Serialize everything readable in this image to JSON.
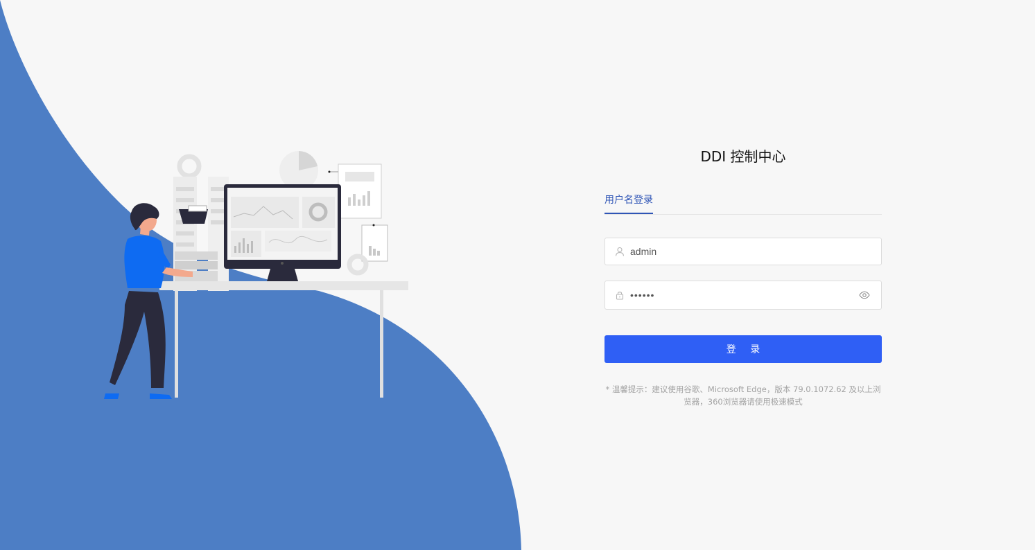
{
  "login": {
    "title": "DDI 控制中心",
    "tab_label": "用户名登录",
    "username_value": "admin",
    "password_masked": "••••••",
    "login_button": "登 录",
    "tip": "* 温馨提示：建议使用谷歌、Microsoft Edge，版本 79.0.1072.62 及以上浏览器，360浏览器请使用极速模式"
  },
  "icons": {
    "user": "user-icon",
    "lock": "lock-icon",
    "eye": "eye-icon"
  },
  "colors": {
    "background": "#f7f7f7",
    "wave": "#4d7ec5",
    "accent": "#2f55b6",
    "button": "#2f5ff5"
  }
}
